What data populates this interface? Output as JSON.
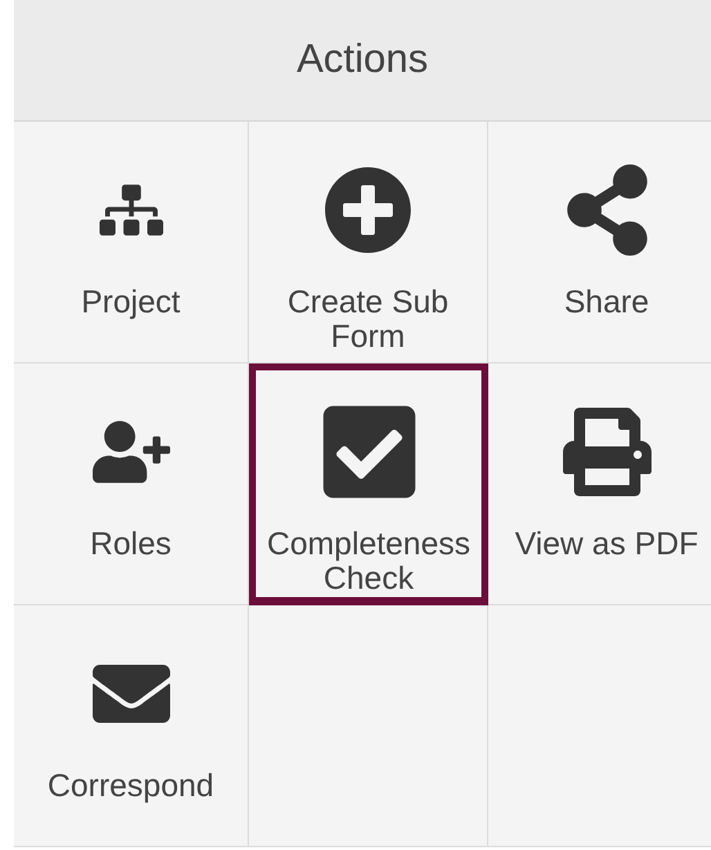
{
  "header": {
    "title": "Actions"
  },
  "actions": [
    {
      "label": "Project",
      "highlighted": false
    },
    {
      "label": "Create Sub Form",
      "highlighted": false
    },
    {
      "label": "Share",
      "highlighted": false
    },
    {
      "label": "Roles",
      "highlighted": false
    },
    {
      "label": "Completeness Check",
      "highlighted": true
    },
    {
      "label": "View as PDF",
      "highlighted": false
    },
    {
      "label": "Correspond",
      "highlighted": false
    }
  ]
}
